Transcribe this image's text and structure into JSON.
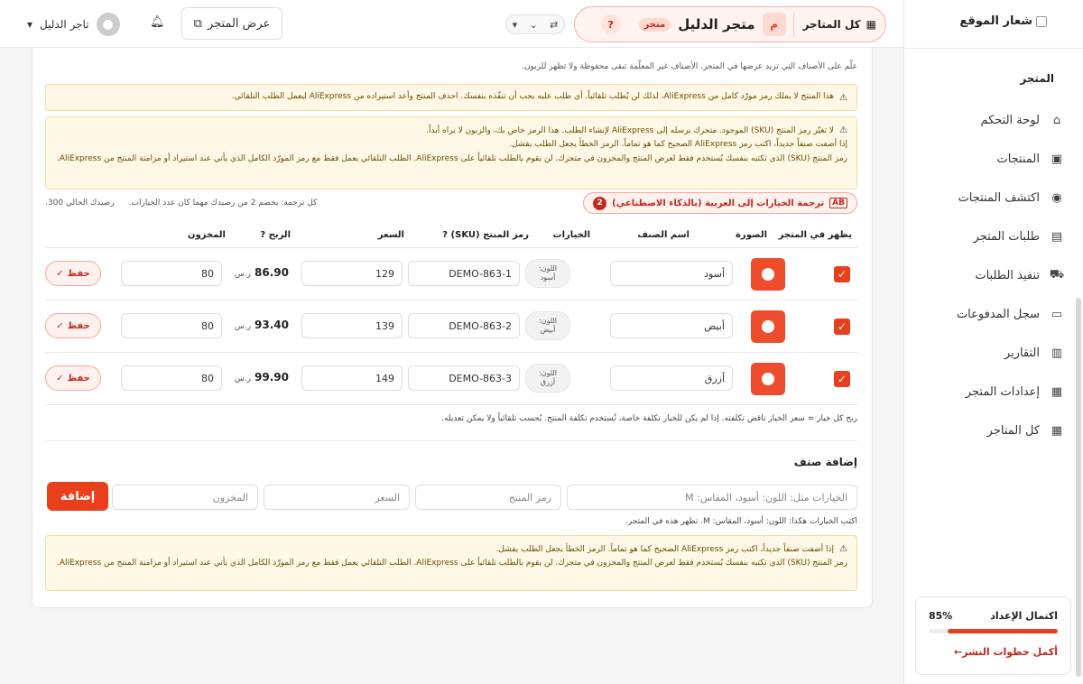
{
  "sidebar": {
    "logo_text": "شعار الموقع",
    "section": "المتجر",
    "items": [
      {
        "label": "لوحة التحكم",
        "icon": "home-icon",
        "glyph": "⌂"
      },
      {
        "label": "المنتجات",
        "icon": "box-icon",
        "glyph": "▣"
      },
      {
        "label": "اكتشف المنتجات",
        "icon": "compass-icon",
        "glyph": "◉"
      },
      {
        "label": "طلبات المتجر",
        "icon": "receipt-icon",
        "glyph": "▤"
      },
      {
        "label": "تنفيذ الطلبات",
        "icon": "truck-icon",
        "glyph": "⛟"
      },
      {
        "label": "سجل المدفوعات",
        "icon": "money-icon",
        "glyph": "▭"
      },
      {
        "label": "التقارير",
        "icon": "chart-icon",
        "glyph": "▥"
      },
      {
        "label": "إعدادات المتجر",
        "icon": "store-icon",
        "glyph": "▦"
      },
      {
        "label": "كل المتاجر",
        "icon": "grid-icon",
        "glyph": "▦"
      }
    ],
    "progress": {
      "label": "اكتمال الإعداد",
      "percent_text": "85%",
      "fraction": 0.85,
      "link": "أكمل خطوات النشر←"
    }
  },
  "topbar": {
    "all_stores": "كل المتاجر",
    "store_initial": "م",
    "store_name": "متجر الدليل",
    "store_tag": "متجر",
    "help": "?",
    "switcher_a": "⇄",
    "switcher_b": "⌄",
    "switcher_c": "▾",
    "view_store": "عرض المتجر",
    "user_name": "تاجر الدليل",
    "user_caret": "▾"
  },
  "main": {
    "hint_top": "علّم على الأصناف التي تريد عرضها في المتجر. الأصناف غير المعلّمة تبقى محفوظة ولا تظهر للزبون.",
    "warn1": "هذا المنتج لا يملك رمز مورّد كامل من AliExpress، لذلك لن يُطلب تلقائياً. أي طلب عليه يجب أن تنفّذه بنفسك. احذف المنتج وأعد استيراده من AliExpress ليعمل الطلب التلقائي.",
    "warn2_line1": "لا تغيّر رمز المنتج (SKU) الموجود. متجرك يرسله إلى AliExpress لإنشاء الطلب. هذا الرمز خاص بك، والزبون لا يراه أبداً.",
    "warn2_line2": "إذا أضفت صنفاً جديداً، اكتب رمز AliExpress الصحيح كما هو تماماً. الرمز الخطأ يجعل الطلب يفشل.",
    "warn2_line3": "رمز المنتج (SKU) الذي تكتبه بنفسك يُستخدم فقط لعرض المنتج والمخزون في متجرك. لن يقوم بالطلب تلقائياً على AliExpress. الطلب التلقائي يعمل فقط مع رمز المورّد الكامل الذي يأتي عند استيراد أو مزامنة المنتج من AliExpress.",
    "ai_button": "ترجمة الخيارات إلى العربية (بالذكاء الاصطناعي)",
    "ai_icon": "AB",
    "ai_count": "2",
    "credit_note": "كل ترجمة: يخصم 2 من رصيدك مهما كان عدد الخيارات.",
    "credit_balance": "رصيدك الحالي 300.",
    "headers": {
      "visible": "يظهر في المتجر",
      "image": "الصورة",
      "name": "اسم الصنف",
      "options": "الخيارات",
      "sku": "رمز المنتج (SKU)",
      "price": "السعر",
      "profit": "الربح",
      "stock": "المخزون",
      "help_glyph": "?"
    },
    "rows": [
      {
        "name": "أسود",
        "opt_key": "اللون:",
        "opt_val": "أسود",
        "sku": "DEMO-863-1",
        "price": "129",
        "profit": "86.90",
        "currency": "ر.س",
        "stock": "80",
        "save": "حفظ",
        "check": "✓"
      },
      {
        "name": "أبيض",
        "opt_key": "اللون:",
        "opt_val": "أبيض",
        "sku": "DEMO-863-2",
        "price": "139",
        "profit": "93.40",
        "currency": "ر.س",
        "stock": "80",
        "save": "حفظ",
        "check": "✓"
      },
      {
        "name": "أزرق",
        "opt_key": "اللون:",
        "opt_val": "أزرق",
        "sku": "DEMO-863-3",
        "price": "149",
        "profit": "99.90",
        "currency": "ر.س",
        "stock": "80",
        "save": "حفظ",
        "check": "✓"
      }
    ],
    "profit_note": "ربح كل خيار = سعر الخيار ناقص تكلفته. إذا لم يكن للخيار تكلفة خاصة، تُستخدم تكلفة المنتج. يُحسب تلقائياً ولا يمكن تعديله.",
    "add_title": "إضافة صنف",
    "add_fields": {
      "options_ph": "الخيارات مثل: اللون: أسود، المقاس: M",
      "sku_ph": "رمز المنتج",
      "price_ph": "السعر",
      "stock_ph": "المخزون"
    },
    "add_button": "إضافة",
    "add_hint": "اكتب الخيارات هكذا: اللون: أسود، المقاس: M. تظهر هذه في المتجر.",
    "warn3_line1": "إذا أضفت صنفاً جديداً، اكتب رمز AliExpress الصحيح كما هو تماماً. الرمز الخطأ يجعل الطلب يفشل.",
    "warn3_line2": "رمز المنتج (SKU) الذي تكتبه بنفسك يُستخدم فقط لعرض المنتج والمخزون في متجرك. لن يقوم بالطلب تلقائياً على AliExpress. الطلب التلقائي يعمل فقط مع رمز المورّد الكامل الذي يأتي عند استيراد أو مزامنة المنتج من AliExpress.",
    "warn_glyph": "⚠"
  },
  "colors": {
    "accent": "#e8401c",
    "warning_bg": "#fff8e6"
  }
}
